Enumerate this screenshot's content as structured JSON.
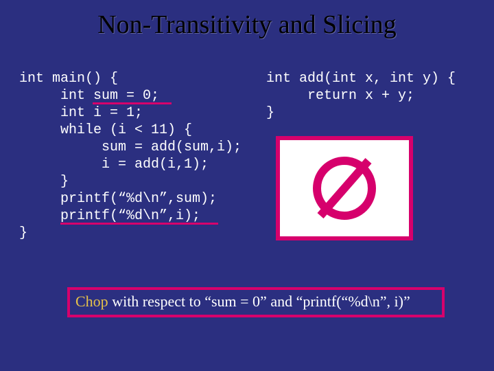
{
  "title": "Non-Transitivity and Slicing",
  "code_main": "int main() {\n     int sum = 0;\n     int i = 1;\n     while (i < 11) {\n          sum = add(sum,i);\n          i = add(i,1);\n     }\n     printf(“%d\\n”,sum);\n     printf(“%d\\n”,i);\n}",
  "code_add": "int add(int x, int y) {\n     return x + y;\n}",
  "empty_set_glyph": "∅",
  "caption_lead": "Chop",
  "caption_rest": " with respect to “sum = 0” and “printf(“%d\\n”, i)”"
}
